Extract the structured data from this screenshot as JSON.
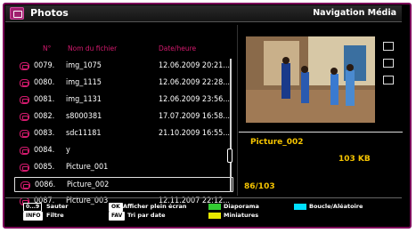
{
  "header": {
    "title": "Photos",
    "mode": "Navigation Média"
  },
  "columns": {
    "num": "N°",
    "name": "Nom du fichier",
    "date": "Date/heure"
  },
  "rows": [
    {
      "num": "0079.",
      "name": "img_1075",
      "date": "12.06.2009 20:21..."
    },
    {
      "num": "0080.",
      "name": "img_1115",
      "date": "12.06.2009 22:28..."
    },
    {
      "num": "0081.",
      "name": "img_1131",
      "date": "12.06.2009 23:56..."
    },
    {
      "num": "0082.",
      "name": "s8000381",
      "date": "17.07.2009 16:58..."
    },
    {
      "num": "0083.",
      "name": "sdc11181",
      "date": "21.10.2009 16:55..."
    },
    {
      "num": "0084.",
      "name": "y",
      "date": ""
    },
    {
      "num": "0085.",
      "name": "Picture_001",
      "date": ""
    },
    {
      "num": "0086.",
      "name": "Picture_002",
      "date": ""
    },
    {
      "num": "0087.",
      "name": "Picture_003",
      "date": "12.11.2007 22:12..."
    }
  ],
  "selected_row": 7,
  "info": {
    "name": "Picture_002",
    "size": "103 KB",
    "count": "86/103"
  },
  "footer": {
    "k1": "0...9",
    "k1_label": "Sauter",
    "k2": "INFO",
    "k2_label": "Filtre",
    "k3": "OK",
    "k3_label": "Afficher plein écran",
    "k4": "FAV",
    "k4_label": "Tri par date",
    "k5_label": "Diaporama",
    "k6_label": "Miniatures",
    "k7_label": "Boucle/Aléatoire"
  },
  "colors": {
    "accent": "#d41a6e",
    "info": "#f5c400",
    "green": "#33cc33",
    "yellow": "#e8e800",
    "cyan": "#00e0ff"
  }
}
